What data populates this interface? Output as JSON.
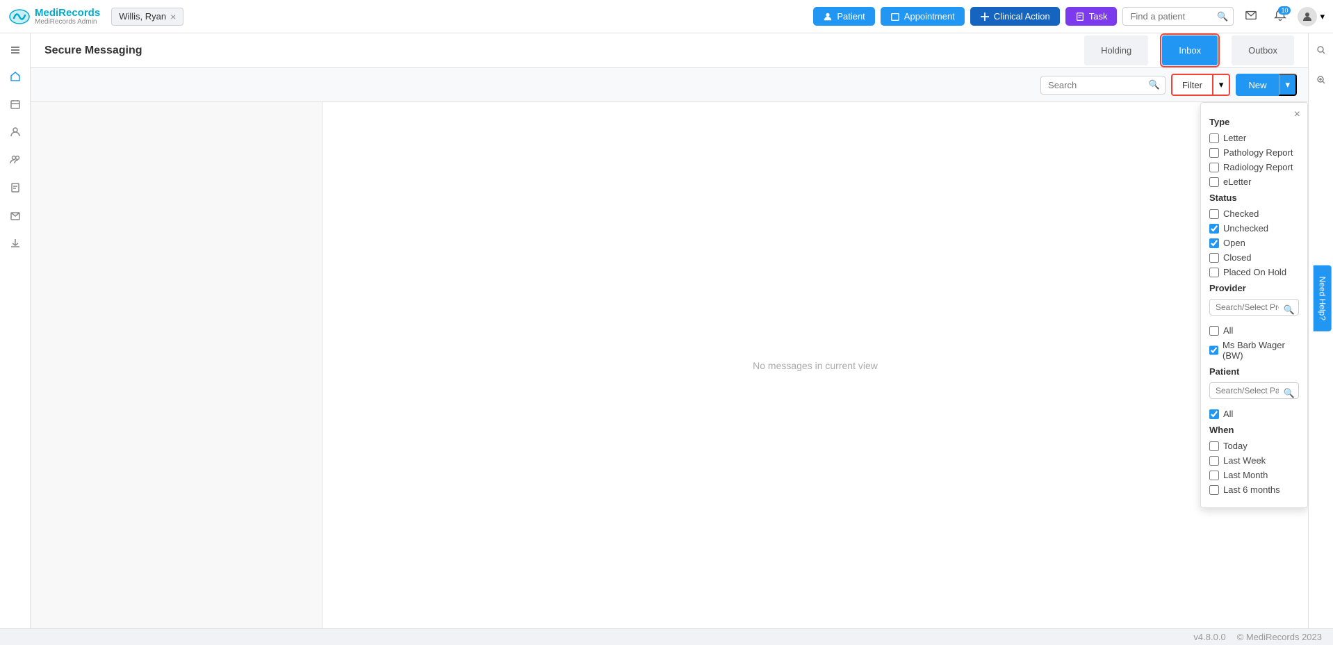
{
  "app": {
    "name": "MediRecords",
    "sub": "MediRecords Admin"
  },
  "nav": {
    "patient_tab": "Willis, Ryan",
    "patient_btn": "Patient",
    "appointment_btn": "Appointment",
    "clinical_btn": "Clinical Action",
    "task_btn": "Task",
    "find_patient_placeholder": "Find a patient",
    "notification_count": "10"
  },
  "page": {
    "title": "Secure Messaging",
    "tabs": [
      {
        "label": "Holding",
        "active": false
      },
      {
        "label": "Inbox",
        "active": true
      },
      {
        "label": "Outbox",
        "active": false
      }
    ]
  },
  "toolbar": {
    "search_placeholder": "Search",
    "filter_label": "Filter",
    "new_label": "New"
  },
  "filter": {
    "close": "×",
    "type_title": "Type",
    "types": [
      {
        "label": "Letter",
        "checked": false
      },
      {
        "label": "Pathology Report",
        "checked": false
      },
      {
        "label": "Radiology Report",
        "checked": false
      },
      {
        "label": "eLetter",
        "checked": false
      }
    ],
    "status_title": "Status",
    "statuses": [
      {
        "label": "Checked",
        "checked": false
      },
      {
        "label": "Unchecked",
        "checked": true
      },
      {
        "label": "Open",
        "checked": true
      },
      {
        "label": "Closed",
        "checked": false
      },
      {
        "label": "Placed On Hold",
        "checked": false
      }
    ],
    "provider_title": "Provider",
    "provider_placeholder": "Search/Select Provider",
    "providers": [
      {
        "label": "All",
        "checked": false
      },
      {
        "label": "Ms Barb Wager (BW)",
        "checked": true
      }
    ],
    "patient_title": "Patient",
    "patient_placeholder": "Search/Select Patient",
    "patients": [
      {
        "label": "All",
        "checked": true
      }
    ],
    "when_title": "When",
    "whens": [
      {
        "label": "Today",
        "checked": false
      },
      {
        "label": "Last Week",
        "checked": false
      },
      {
        "label": "Last Month",
        "checked": false
      },
      {
        "label": "Last 6 months",
        "checked": false
      }
    ]
  },
  "main": {
    "empty_message": "No messages in current view"
  },
  "status_bar": {
    "version": "v4.8.0.0",
    "rights": "© MediRecords 2023"
  }
}
